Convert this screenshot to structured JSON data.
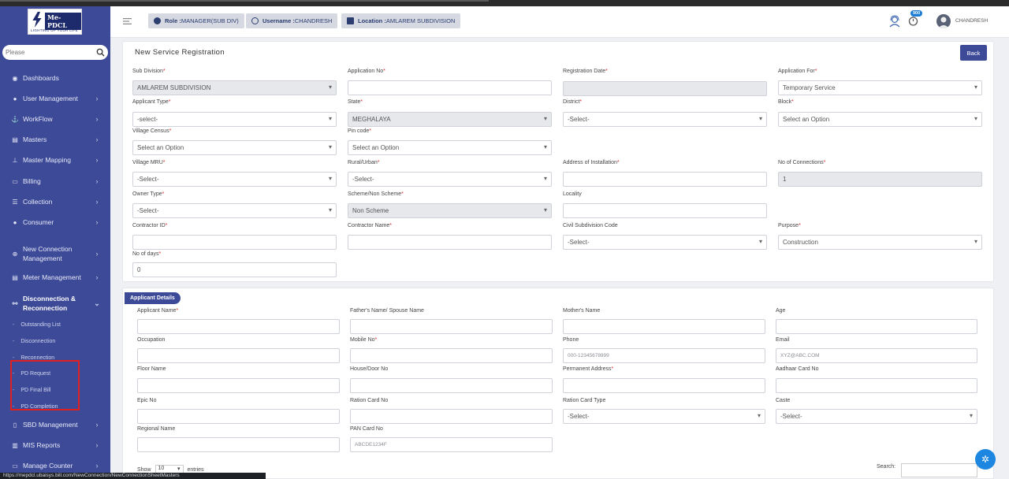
{
  "brand": {
    "name": "Me-PDCL",
    "tagline": "LIGHTING UP YOUR LIFE"
  },
  "sidebar": {
    "search_placeholder": "Please",
    "menu": [
      {
        "label": "Dashboards",
        "icon": "palette-icon",
        "chevron": ""
      },
      {
        "label": "User Management",
        "icon": "user-icon",
        "chevron": "›"
      },
      {
        "label": "WorkFlow",
        "icon": "anchor-icon",
        "chevron": "›"
      },
      {
        "label": "Masters",
        "icon": "list-icon",
        "chevron": "›"
      },
      {
        "label": "Master Mapping",
        "icon": "sitemap-icon",
        "chevron": "›"
      },
      {
        "label": "Billing",
        "icon": "monitor-icon",
        "chevron": "›"
      },
      {
        "label": "Collection",
        "icon": "list-icon",
        "chevron": "›"
      },
      {
        "label": "Consumer",
        "icon": "user-icon",
        "chevron": "›"
      },
      {
        "label": "New Connection Management",
        "icon": "plus-circle-icon",
        "chevron": "›"
      },
      {
        "label": "Meter Management",
        "icon": "list-icon",
        "chevron": "›"
      },
      {
        "label": "Disconnection & Reconnection",
        "icon": "link-icon",
        "chevron": "⌄"
      },
      {
        "label": "SBD Management",
        "icon": "phone-icon",
        "chevron": "›"
      },
      {
        "label": "MIS Reports",
        "icon": "bar-chart-icon",
        "chevron": "›"
      },
      {
        "label": "Manage Counter",
        "icon": "monitor-icon",
        "chevron": "›"
      }
    ],
    "submenu": [
      "Outstanding List",
      "Disconnection",
      "Reconnection",
      "PD Request",
      "PD Final Bill",
      "PD Completion"
    ]
  },
  "header": {
    "role_label": "Role :",
    "role_value": "MANAGER(SUB DIV)",
    "username_label": "Username :",
    "username_value": "CHANDRESH",
    "location_label": "Location :",
    "location_value": "AMLAREM SUBDIVISION",
    "badge": "900",
    "user": "CHANDRESH"
  },
  "form": {
    "title": "New Service Registration",
    "back_label": "Back",
    "section_applicant": "Applicant Details",
    "show_label": "Show",
    "entries_value": "10",
    "entries_label": "entries",
    "search_label": "Search:"
  },
  "status_url": "https://mepdcl.ubaisys.bill.com/NewConnection/NewConnectionSheetMasters"
}
